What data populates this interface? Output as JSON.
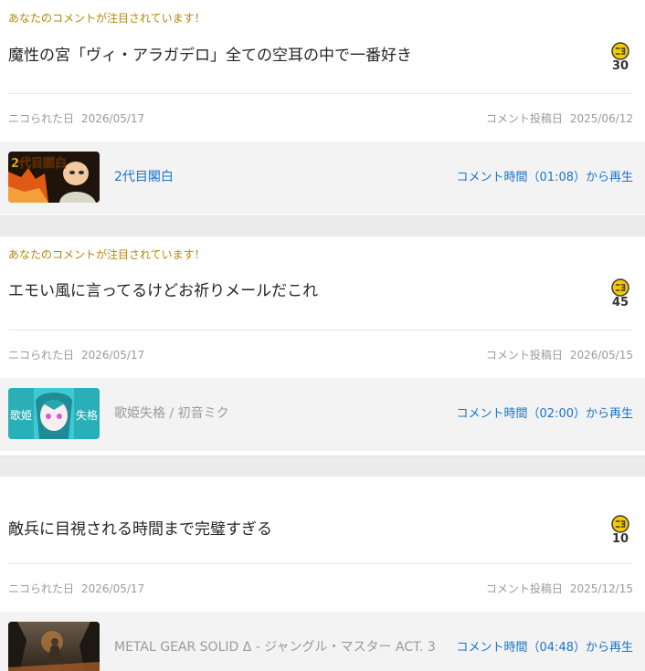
{
  "comments": [
    {
      "notice": "あなたのコメントが注目されています！",
      "text": "魔性の宮「ヴィ・アラガデロ」全ての空耳の中で一番好き",
      "nico_count": "30",
      "niko_label": "ニコられた日",
      "niko_date": "2026/05/17",
      "posted_label": "コメント投稿日",
      "posted_date": "2025/06/12",
      "video_title": "2代目閣白",
      "play_label": "コメント時間（01:08）から再生"
    },
    {
      "notice": "あなたのコメントが注目されています！",
      "text": "エモい風に言ってるけどお祈りメールだこれ",
      "nico_count": "45",
      "niko_label": "ニコられた日",
      "niko_date": "2026/05/17",
      "posted_label": "コメント投稿日",
      "posted_date": "2026/05/15",
      "video_title": "歌姫失格 / 初音ミク",
      "play_label": "コメント時間（02:00）から再生"
    },
    {
      "notice": "",
      "text": "敵兵に目視される時間まで完璧すぎる",
      "nico_count": "10",
      "niko_label": "ニコられた日",
      "niko_date": "2026/05/17",
      "posted_label": "コメント投稿日",
      "posted_date": "2025/12/15",
      "video_title": "METAL GEAR SOLID Δ - ジャングル・マスター ACT. 3",
      "play_label": "コメント時間（04:48）から再生"
    }
  ],
  "thumbnails": {
    "first_logo_text": "2代目閣白",
    "second_left_text": "歌姫",
    "second_right_text": "失格"
  },
  "colors": {
    "notice": "#b8860b",
    "link": "#1a73c9",
    "nico_badge": "#f6c800"
  },
  "icons": {
    "nico": "nico-coin-icon"
  }
}
